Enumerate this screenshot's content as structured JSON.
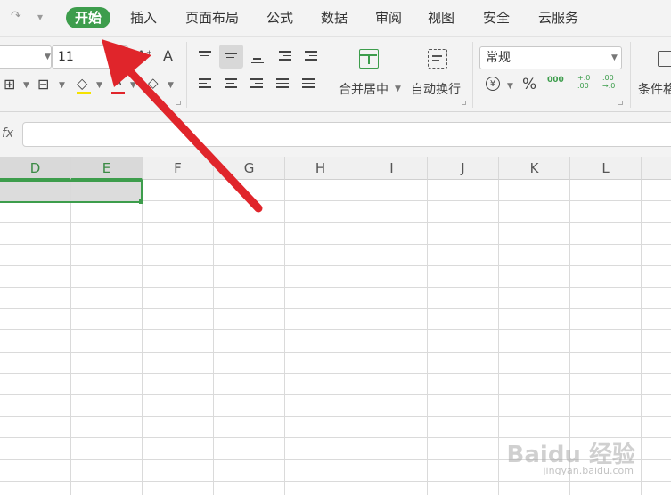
{
  "tabs": [
    "开始",
    "插入",
    "页面布局",
    "公式",
    "数据",
    "审阅",
    "视图",
    "安全",
    "云服务"
  ],
  "quick_access": {
    "redo_icon": "redo-icon",
    "more_icon": "chevron-down-icon"
  },
  "ribbon": {
    "font_size": "11",
    "merge_center_label": "合并居中",
    "wrap_text_label": "自动换行",
    "number_format": "常规",
    "cond_format_label": "条件格",
    "currency_symbol": "¥",
    "percent_symbol": "%",
    "thousands_symbol": "000",
    "dec_inc_symbol": "+.0\n.00",
    "dec_dec_symbol": ".00\n→.0",
    "font_grow": "A+",
    "font_shrink": "A-"
  },
  "formula_bar": {
    "fx_label": "fx",
    "value": ""
  },
  "columns": [
    "D",
    "E",
    "F",
    "G",
    "H",
    "I",
    "J",
    "K",
    "L"
  ],
  "selected_columns": [
    "D",
    "E"
  ],
  "watermark": {
    "main": "Baidu 经验",
    "sub": "jingyan.baidu.com"
  },
  "colors": {
    "accent": "#3d9d4c",
    "arrow": "#e0252b"
  }
}
